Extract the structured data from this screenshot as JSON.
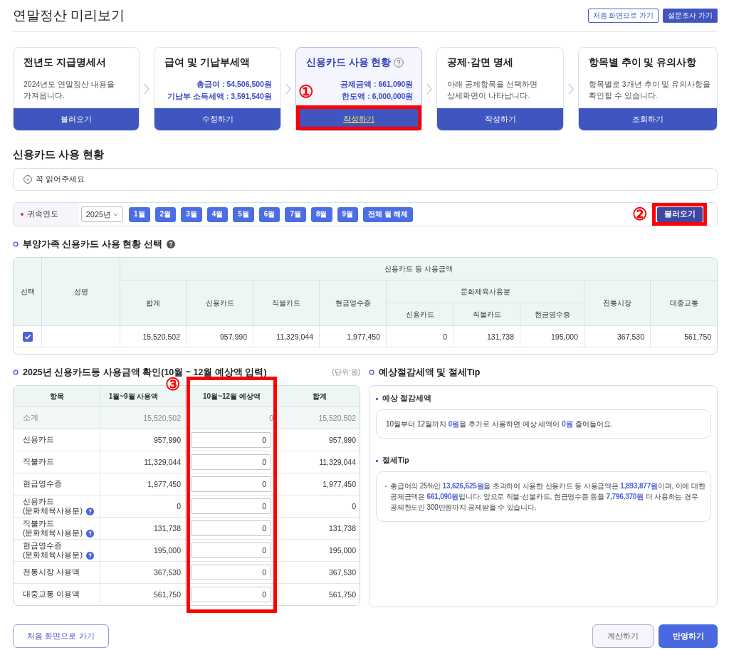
{
  "header": {
    "title": "연말정산 미리보기",
    "buttons": [
      {
        "label": "처음 화면으로 가기",
        "kind": "outline"
      },
      {
        "label": "설문조사 가기",
        "kind": "filled"
      }
    ]
  },
  "steps": [
    {
      "title": "전년도 지급명세서",
      "kind": "text",
      "description": "2024년도 연말정산 내용을\n가져옵니다.",
      "button": "불러오기",
      "selected": false,
      "help": false
    },
    {
      "title": "급여 및 기납부세액",
      "kind": "amounts",
      "amounts": [
        "총급여 : 54,506,500원",
        "기납부 소득세액 : 3,591,540원"
      ],
      "button": "수정하기",
      "selected": false,
      "help": false
    },
    {
      "title": "신용카드 사용 현황",
      "kind": "amounts",
      "amounts": [
        "공제금액 : 661,090원",
        "한도액 : 6,000,000원"
      ],
      "button": "작성하기",
      "selected": true,
      "help": true,
      "callout": "①"
    },
    {
      "title": "공제·감면 명세",
      "kind": "text",
      "description": "아래 공제항목을 선택하면\n상세화면이 나타납니다.",
      "button": "작성하기",
      "selected": false,
      "help": false
    },
    {
      "title": "항목별 추이 및 유의사항",
      "kind": "text",
      "description": "항목별로 3개년 추이 및 유의사항을\n확인할 수 있습니다.",
      "button": "조회하기",
      "selected": false,
      "help": false
    }
  ],
  "section_title": "신용카드 사용 현황",
  "notice": {
    "label": "꼭 읽어주세요"
  },
  "filter": {
    "label": "귀속연도",
    "required": true,
    "year": "2025년",
    "months": [
      {
        "label": "1월",
        "selected": true
      },
      {
        "label": "2월",
        "selected": true
      },
      {
        "label": "3월",
        "selected": true
      },
      {
        "label": "4월",
        "selected": true
      },
      {
        "label": "5월",
        "selected": true
      },
      {
        "label": "6월",
        "selected": true
      },
      {
        "label": "7월",
        "selected": true
      },
      {
        "label": "8월",
        "selected": true
      },
      {
        "label": "9월",
        "selected": true
      }
    ],
    "clear_button": "전체 월 해제",
    "load_button": "불러오기",
    "callout": "②"
  },
  "dependents": {
    "title": "부양가족 신용카드 사용 현황 선택",
    "help": true,
    "headers": {
      "select": "선택",
      "name": "성명",
      "group": "신용카드 등 사용금액",
      "total": "합계",
      "credit": "신용카드",
      "debit": "직불카드",
      "cash": "현금영수증",
      "culture": "문화체육사용분",
      "culture_columns": [
        "신용카드",
        "직불카드",
        "현금영수증"
      ],
      "market": "전통시장",
      "transit": "대중교통"
    },
    "rows": [
      {
        "checked": true,
        "values": [
          "15,520,502",
          "957,990",
          "11,329,044",
          "1,977,450",
          "0",
          "131,738",
          "195,000",
          "367,530",
          "561,750"
        ]
      }
    ]
  },
  "usage": {
    "title": "2025년 신용카드등 사용금액 확인(10월 ~ 12월 예상액 입력)",
    "unit": "(단위:원)",
    "columns": [
      "항목",
      "1월~9월 사용액",
      "10월~12월 예상액",
      "합계"
    ],
    "callout": "③",
    "rows": [
      {
        "kind": "subtotal",
        "item": "소계",
        "help": false,
        "used": "15,520,502",
        "expected": "0",
        "total": "15,520,502"
      },
      {
        "kind": "input",
        "item": "신용카드",
        "help": false,
        "used": "957,990",
        "expected": "0",
        "total": "957,990"
      },
      {
        "kind": "input",
        "item": "직불카드",
        "help": false,
        "used": "11,329,044",
        "expected": "0",
        "total": "11,329,044"
      },
      {
        "kind": "input",
        "item": "현금영수증",
        "help": false,
        "used": "1,977,450",
        "expected": "0",
        "total": "1,977,450"
      },
      {
        "kind": "input",
        "item": "신용카드",
        "note": "(문화체육사용분)",
        "help": true,
        "used": "0",
        "expected": "0",
        "total": "0"
      },
      {
        "kind": "input",
        "item": "직불카드",
        "note": "(문화체육사용분)",
        "help": true,
        "used": "131,738",
        "expected": "0",
        "total": "131,738"
      },
      {
        "kind": "input",
        "item": "현금영수증",
        "note": "(문화체육사용분)",
        "help": true,
        "used": "195,000",
        "expected": "0",
        "total": "195,000"
      },
      {
        "kind": "input",
        "item": "전통시장 사용액",
        "help": false,
        "used": "367,530",
        "expected": "0",
        "total": "367,530"
      },
      {
        "kind": "input",
        "item": "대중교통 이용액",
        "help": false,
        "used": "561,750",
        "expected": "0",
        "total": "561,750"
      }
    ]
  },
  "tips": {
    "title": "예상절감세액 및 절세Tip",
    "estimate_heading": "예상 절감세액",
    "estimate_text": "10월부터 12월까지 **0원**을 추가로 사용하면 예상 세액이 **0원** 줄어들어요.",
    "tip_heading": "절세Tip",
    "tip_text": "총급여의 25%인 **13,626,625원**을 초과하여 사용한 신용카드 등 사용금액은 **1,893,877원**이며, 이에 대한 공제금액은 **661,090원**입니다. 앞으로 직불·선불카드, 현금영수증 등을 **7,796,370원** 더 사용하는 경우 공제한도인 300만원까지 공제받을 수 있습니다."
  },
  "footer": {
    "home_button": "처음 화면으로 가기",
    "calculate_button": "계산하기",
    "apply_button": "반영하기"
  }
}
